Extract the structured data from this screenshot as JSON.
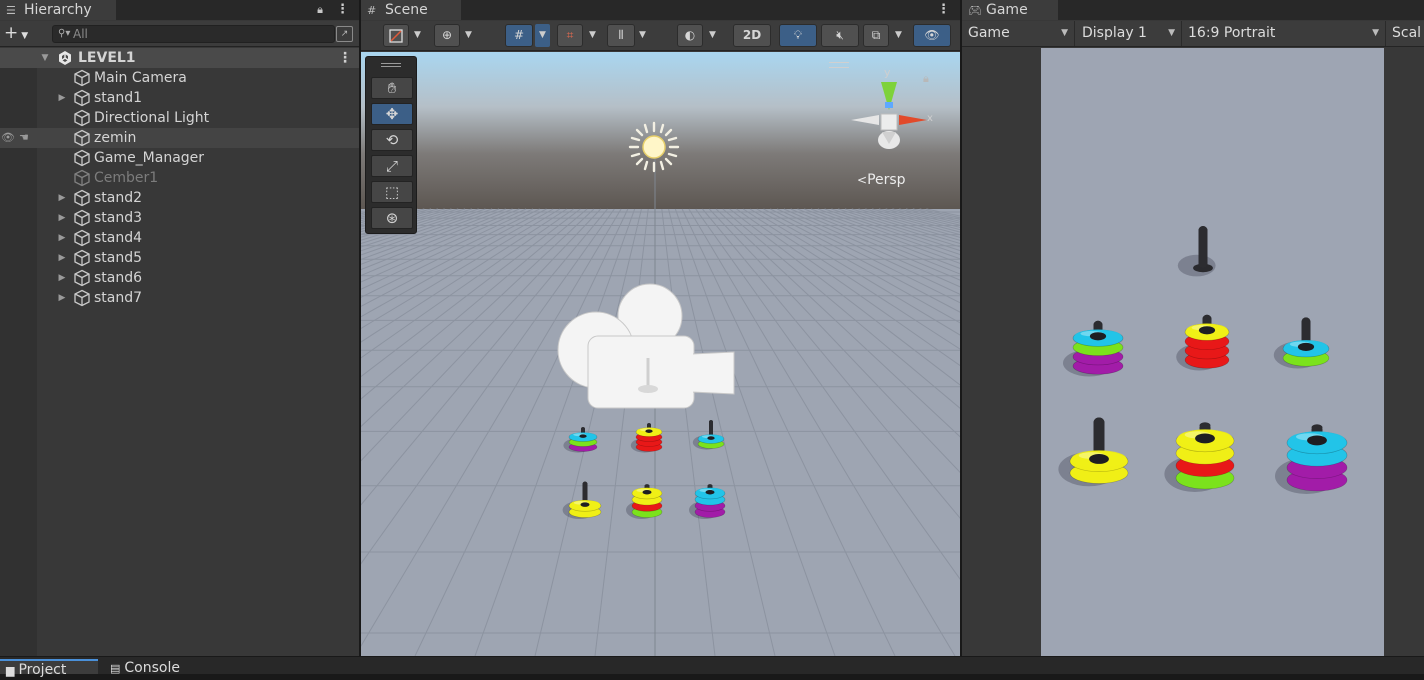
{
  "hierarchy": {
    "tab_label": "Hierarchy",
    "add_label": "+",
    "search_placeholder": "All",
    "scene_name": "LEVEL1",
    "items": [
      {
        "label": "Main Camera",
        "expandable": false,
        "dim": false
      },
      {
        "label": "stand1",
        "expandable": true,
        "dim": false
      },
      {
        "label": "Directional Light",
        "expandable": false,
        "dim": false
      },
      {
        "label": "zemin",
        "expandable": false,
        "dim": false
      },
      {
        "label": "Game_Manager",
        "expandable": false,
        "dim": false
      },
      {
        "label": "Cember1",
        "expandable": false,
        "dim": true
      },
      {
        "label": "stand2",
        "expandable": true,
        "dim": false
      },
      {
        "label": "stand3",
        "expandable": true,
        "dim": false
      },
      {
        "label": "stand4",
        "expandable": true,
        "dim": false
      },
      {
        "label": "stand5",
        "expandable": true,
        "dim": false
      },
      {
        "label": "stand6",
        "expandable": true,
        "dim": false
      },
      {
        "label": "stand7",
        "expandable": true,
        "dim": false
      }
    ]
  },
  "scene": {
    "tab_label": "Scene",
    "toggle_2d": "2D",
    "persp_label": "Persp",
    "axis_y": "y",
    "axis_x": "x",
    "tools": [
      "hand-tool",
      "move-tool",
      "rotate-tool",
      "scale-tool",
      "rect-tool",
      "transform-tool"
    ]
  },
  "game": {
    "tab_label": "Game",
    "mode_dropdown": "Game",
    "display_dropdown": "Display 1",
    "aspect_dropdown": "16:9 Portrait",
    "scale_label": "Scal"
  },
  "bottom": {
    "project_tab": "Project",
    "console_tab": "Console"
  },
  "colors": {
    "selection_blue": "#3c5f87",
    "ring_cyan": "#22c4e8",
    "ring_green": "#7be21c",
    "ring_purple": "#a21ca8",
    "ring_red": "#e81818",
    "ring_yellow": "#f0ef16"
  }
}
